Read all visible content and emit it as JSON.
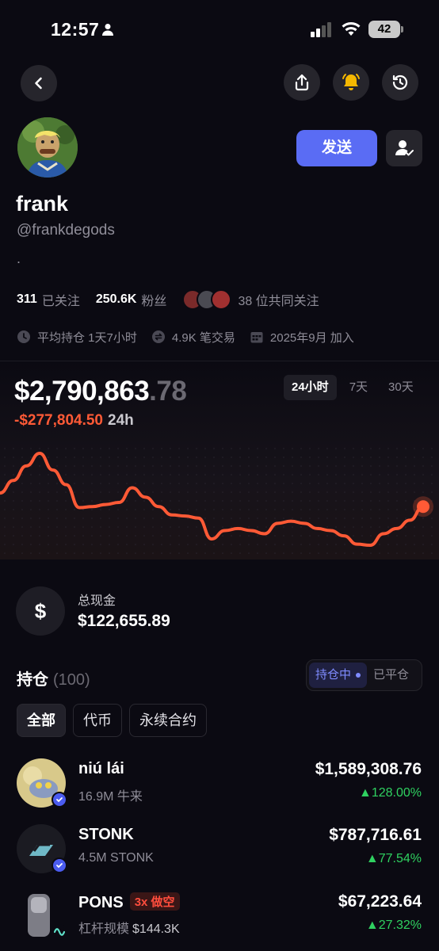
{
  "status_bar": {
    "time": "12:57",
    "battery": "42"
  },
  "profile": {
    "name": "frank",
    "handle": "@frankdegods",
    "bio": ".",
    "send_label": "发送",
    "following_count": "311",
    "following_label": "已关注",
    "followers_count": "250.6K",
    "followers_label": "粉丝",
    "mutual_label": "38 位共同关注",
    "avg_hold": "平均持仓 1天7小时",
    "trades": "4.9K 笔交易",
    "joined": "2025年9月 加入"
  },
  "portfolio": {
    "balance_main": "$2,790,863",
    "balance_cents": ".78",
    "change_value": "-$277,804.50",
    "change_period": "24h",
    "periods": [
      "24小时",
      "7天",
      "30天"
    ],
    "active_period": "24小时"
  },
  "chart_data": {
    "type": "line",
    "series": [
      {
        "values": [
          2810000,
          2822000,
          2836000,
          2848000,
          2832000,
          2818000,
          2796000,
          2797000,
          2799000,
          2801000,
          2815000,
          2806000,
          2797000,
          2789000,
          2788000,
          2786000,
          2766000,
          2774000,
          2776000,
          2774000,
          2771000,
          2781000,
          2783000,
          2781000,
          2776000,
          2774000,
          2769000,
          2761000,
          2760000,
          2771000,
          2776000,
          2784000,
          2797000
        ]
      }
    ],
    "colors": {
      "line": "#ff5a36",
      "dot": "#ff5a36"
    }
  },
  "cash": {
    "label": "总现金",
    "value": "$122,655.89"
  },
  "holdings": {
    "title": "持仓",
    "count": "(100)",
    "toggle_open": "持仓中",
    "toggle_closed": "已平仓",
    "filters": [
      "全部",
      "代币",
      "永续合约"
    ],
    "items": [
      {
        "name": "niú lái",
        "sub": "16.9M 牛来",
        "value": "$1,589,308.76",
        "change": "▲128.00%"
      },
      {
        "name": "STONK",
        "sub": "4.5M STONK",
        "value": "$787,716.61",
        "change": "▲77.54%"
      },
      {
        "name": "PONS",
        "tag": "3x 做空",
        "sub_label": "杠杆规模",
        "sub_value": "$144.3K",
        "value": "$67,223.64",
        "change": "▲27.32%"
      }
    ]
  },
  "colors": {
    "accent": "#5a6cf4",
    "negative": "#ff5a36",
    "positive": "#2fd160",
    "bell": "#f5b800"
  }
}
